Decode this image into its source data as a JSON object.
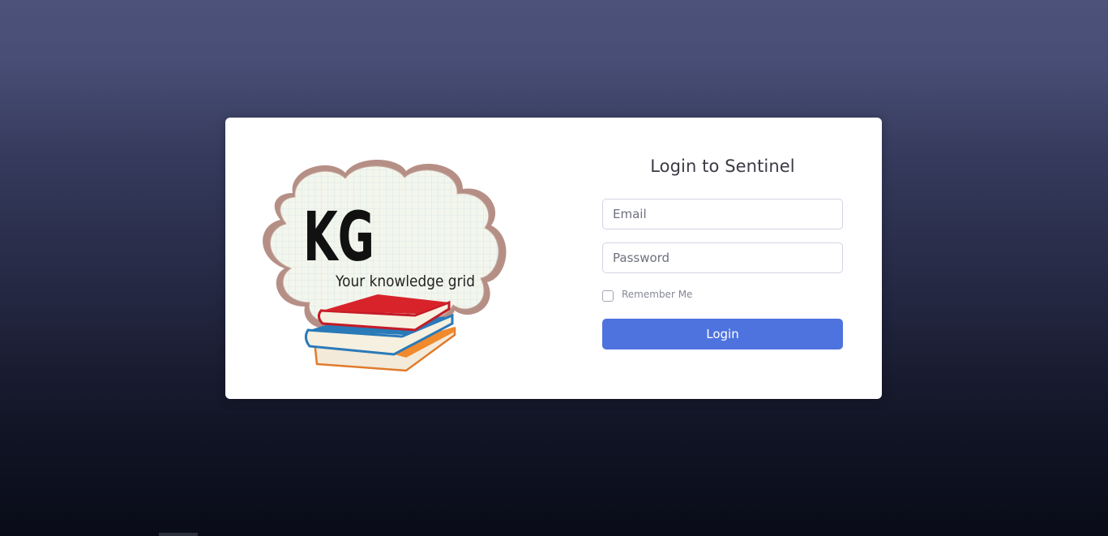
{
  "logo": {
    "initials": "KG",
    "tagline": "Your knowledge grid"
  },
  "login_form": {
    "title": "Login to Sentinel",
    "email_placeholder": "Email",
    "email_value": "",
    "password_placeholder": "Password",
    "password_value": "",
    "remember_label": "Remember Me",
    "remember_checked": false,
    "submit_label": "Login"
  },
  "colors": {
    "accent": "#4e73df",
    "card_background": "#ffffff",
    "title_text": "#3a3b45",
    "placeholder_text": "#6e707e"
  }
}
